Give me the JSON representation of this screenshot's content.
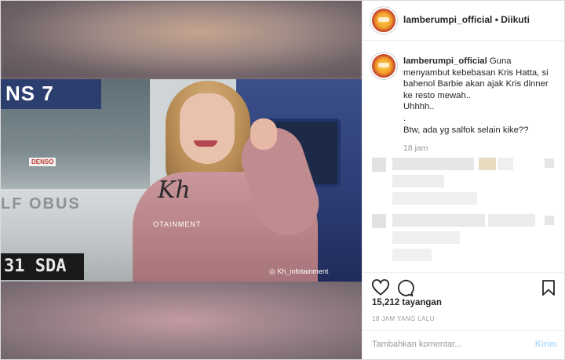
{
  "header": {
    "username": "lamberumpi_official",
    "separator": "•",
    "follow_status": "Diikuti"
  },
  "caption": {
    "username": "lamberumpi_official",
    "lines": [
      "Guna menyambut kebebasan Kris Hatta, si bahenol Barbie akan ajak Kris dinner ke resto mewah..",
      "Uhhhh..",
      ".",
      "Btw, ada yg salfok selain kike??"
    ],
    "time": "18 jam"
  },
  "media": {
    "sign_text": "NS 7",
    "denso_text": "DENSO",
    "car_logo": "LF OBUS",
    "plate_text": "31 SDA",
    "watermark_main": "Kh",
    "watermark_sub": "OTAINMENT",
    "watermark_corner": "◎ Kh_infotainment"
  },
  "actions": {
    "like_icon": "heart-icon",
    "comment_icon": "comment-icon",
    "bookmark_icon": "bookmark-icon",
    "views": "15,212 tayangan",
    "time_ago": "18 JAM YANG LALU"
  },
  "comment_box": {
    "placeholder": "Tambahkan komentar...",
    "post_label": "Kirim"
  }
}
